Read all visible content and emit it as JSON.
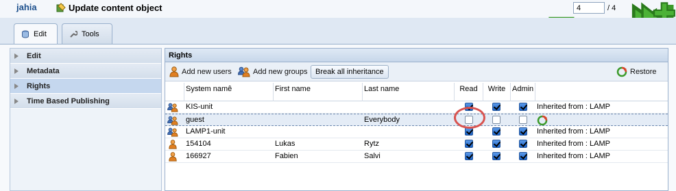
{
  "header": {
    "logo": "jahia",
    "title": "Update content object",
    "page_value": "4",
    "page_total": "/ 4"
  },
  "tabs": [
    {
      "label": "Edit",
      "icon": "database-icon",
      "active": true
    },
    {
      "label": "Tools",
      "icon": "wrench-icon",
      "active": false
    }
  ],
  "sidebar": {
    "items": [
      {
        "label": "Edit",
        "selected": false
      },
      {
        "label": "Metadata",
        "selected": false
      },
      {
        "label": "Rights",
        "selected": true
      },
      {
        "label": "Time Based Publishing",
        "selected": false
      }
    ]
  },
  "panel": {
    "title": "Rights",
    "toolbar": {
      "add_users": "Add new users",
      "add_groups": "Add new groups",
      "break_inheritance": "Break all inheritance",
      "restore": "Restore"
    },
    "columns": {
      "system_name": "System namê",
      "first_name": "First name",
      "last_name": "Last name",
      "read": "Read",
      "write": "Write",
      "admin": "Admin"
    },
    "rows": [
      {
        "type": "group",
        "system_name": "KIS-unit",
        "first_name": "",
        "last_name": "",
        "read": true,
        "write": true,
        "admin": true,
        "inherited": "Inherited from : LAMP"
      },
      {
        "type": "group",
        "system_name": "guest",
        "first_name": "",
        "last_name": "Everybody",
        "read": false,
        "write": false,
        "admin": false,
        "inherited": ""
      },
      {
        "type": "group",
        "system_name": "LAMP1-unit",
        "first_name": "",
        "last_name": "",
        "read": true,
        "write": true,
        "admin": true,
        "inherited": "Inherited from : LAMP"
      },
      {
        "type": "user",
        "system_name": "154104",
        "first_name": "Lukas",
        "last_name": "Rytz",
        "read": true,
        "write": true,
        "admin": true,
        "inherited": "Inherited from : LAMP"
      },
      {
        "type": "user",
        "system_name": "166927",
        "first_name": "Fabien",
        "last_name": "Salvi",
        "read": true,
        "write": true,
        "admin": true,
        "inherited": "Inherited from : LAMP"
      }
    ]
  },
  "colors": {
    "header_bg": "#dfe9f5",
    "checkbox_checked": "#1a62c8",
    "highlight_circle": "#d9534f"
  }
}
